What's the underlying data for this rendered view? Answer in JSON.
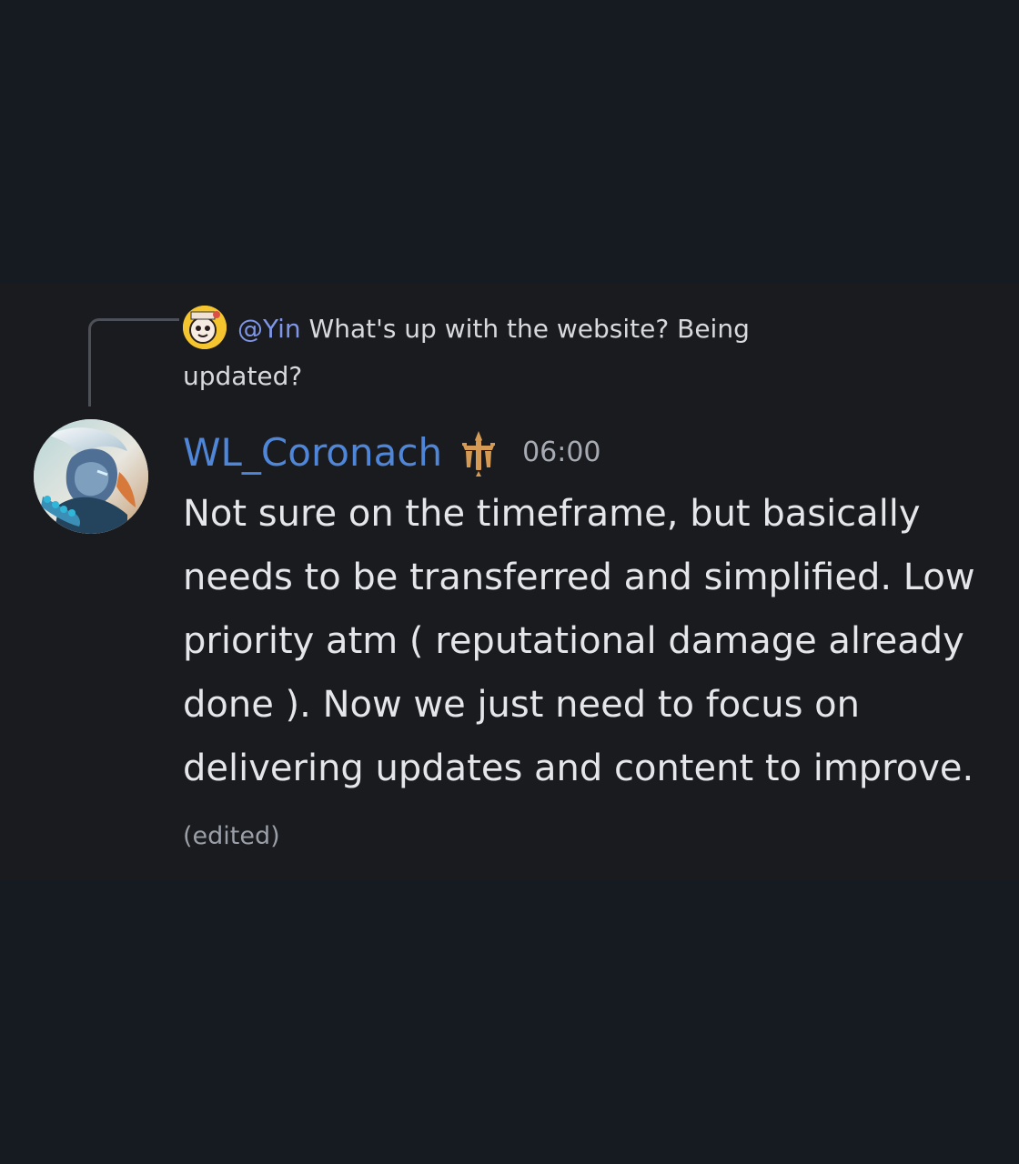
{
  "reply": {
    "mention": "@Yin",
    "text": "What's up with the website? Being updated?"
  },
  "message": {
    "author": "WL_Coronach",
    "timestamp": "06:00",
    "body": "Not sure on the timeframe, but basically needs to be transferred and simplified. Low priority atm ( reputational damage already done ). Now we just need to focus on delivering updates and content to improve.",
    "edited_label": "(edited)"
  },
  "colors": {
    "background": "#161a21",
    "panel": "#1a1b1f",
    "author": "#4f86d8",
    "mention": "#7f96e7",
    "role_icon": "#d59a54"
  },
  "icons": {
    "reply_avatar": "reply-avatar-icon",
    "role_badge": "sword-crest-icon"
  }
}
